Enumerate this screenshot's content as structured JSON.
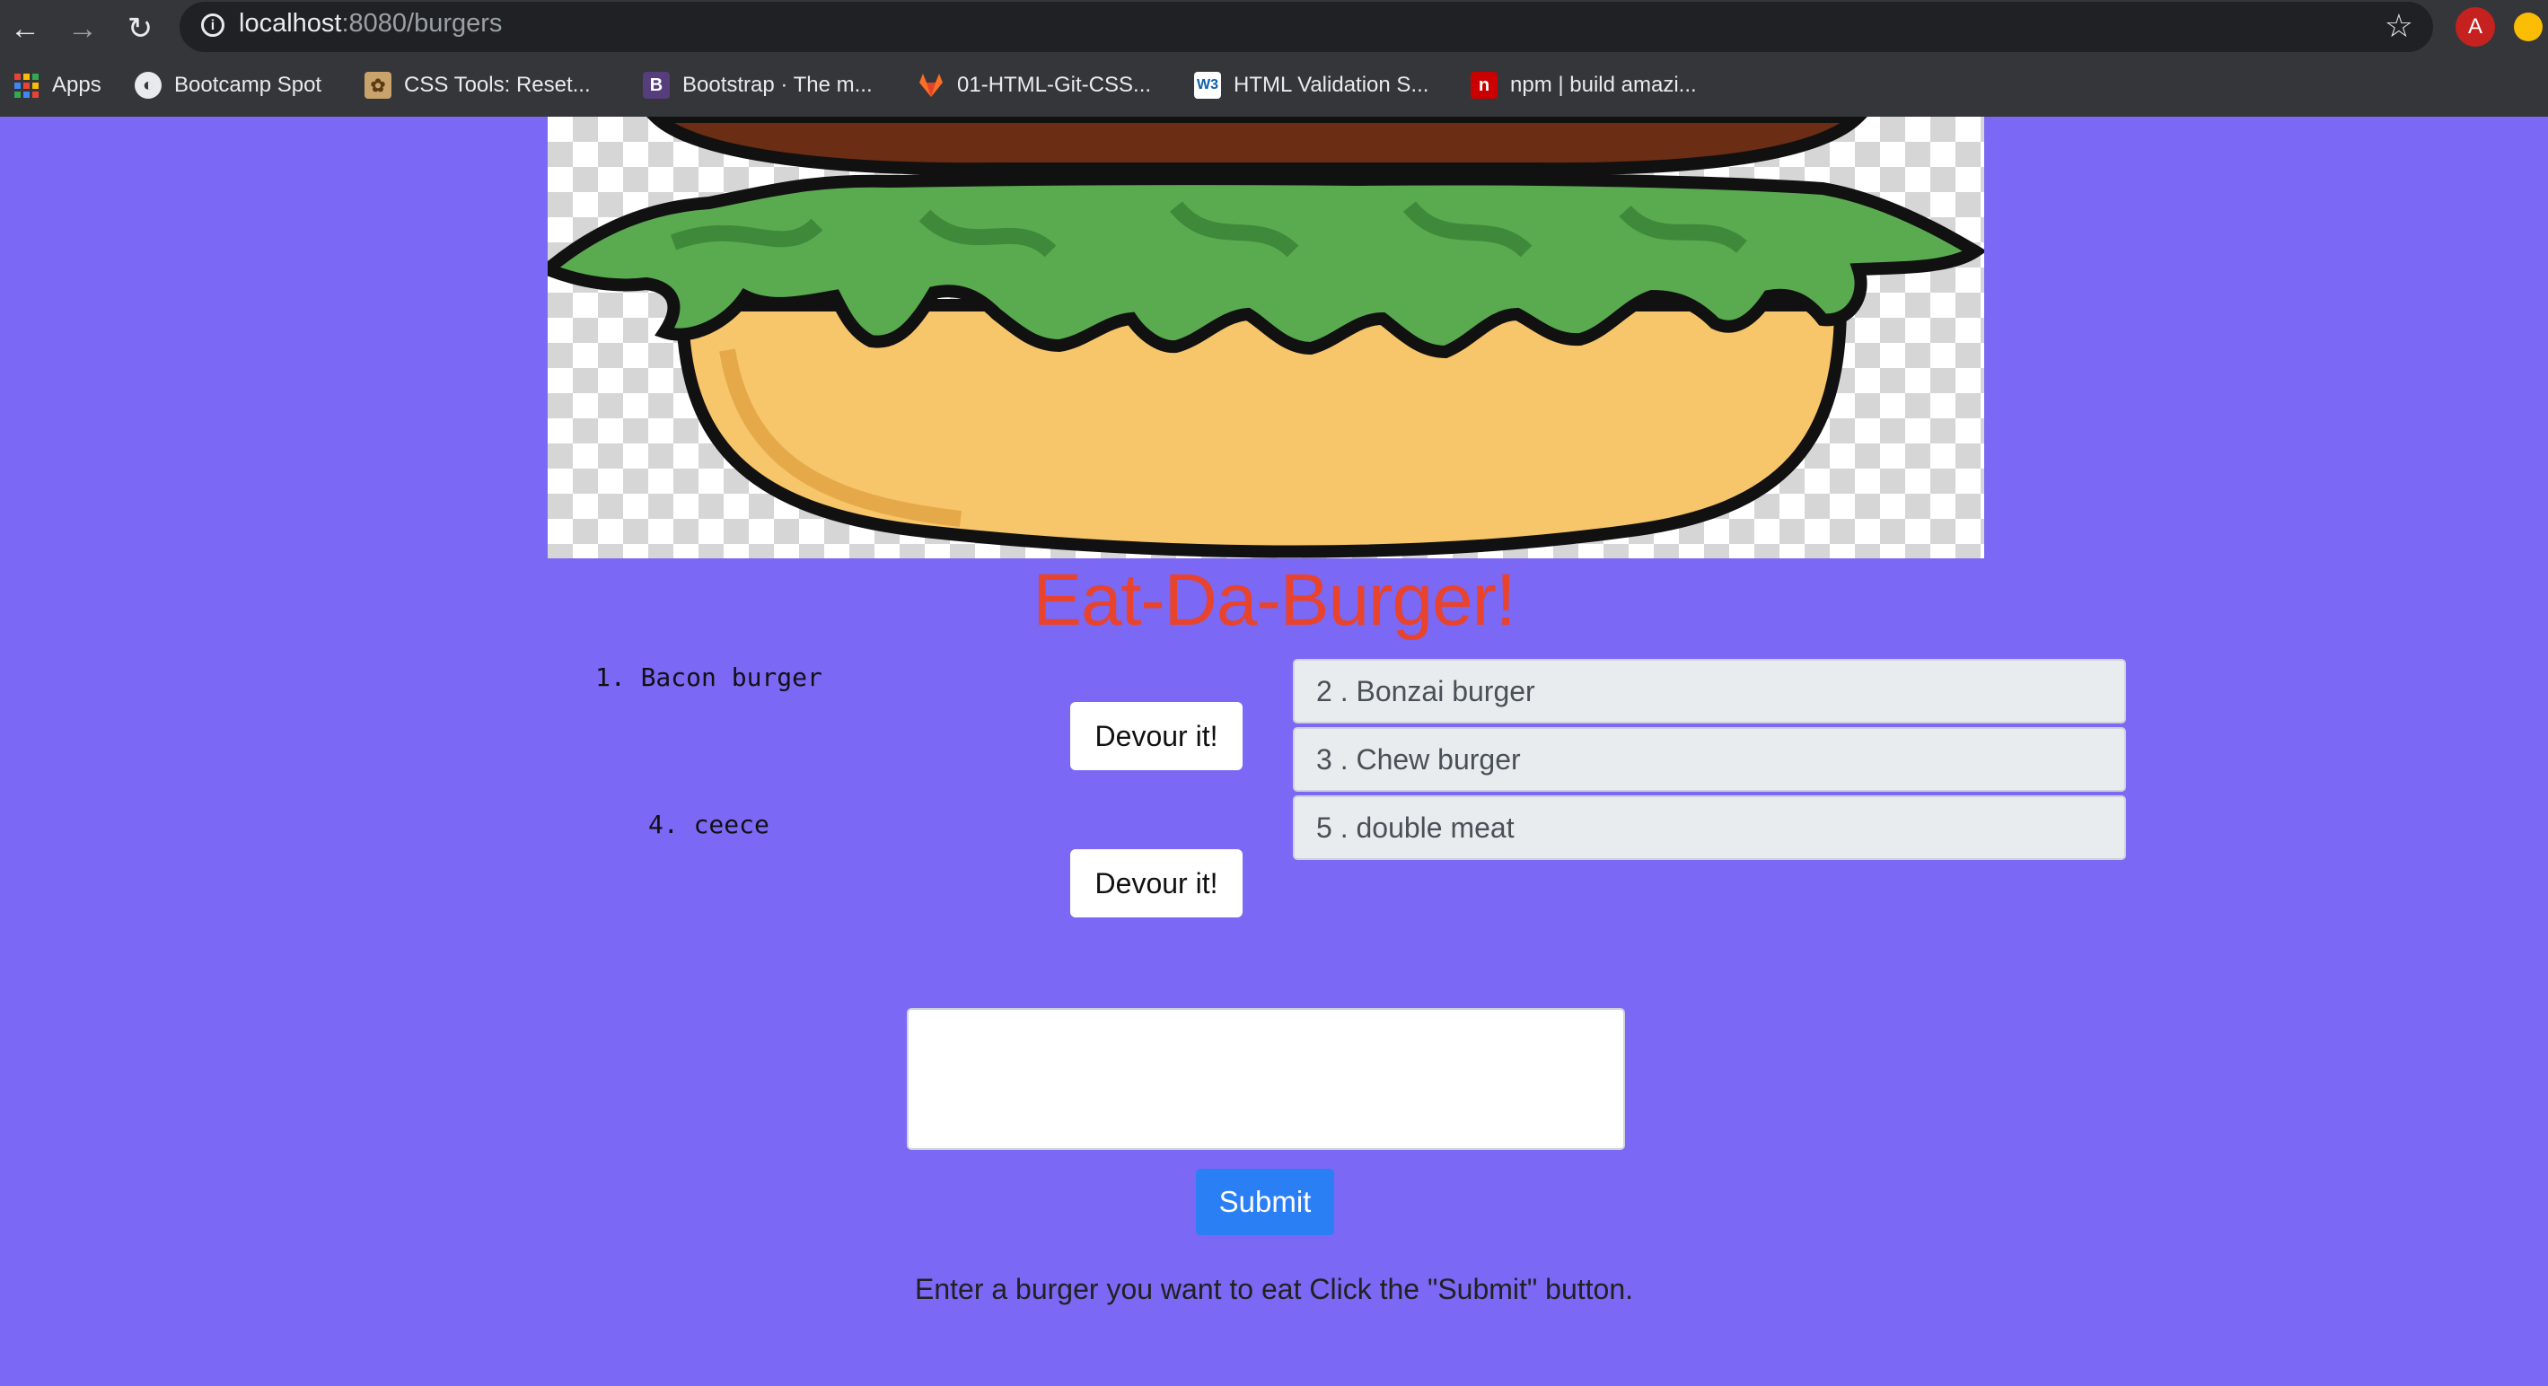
{
  "browser": {
    "url_host": "localhost",
    "url_path": ":8080/burgers",
    "avatar_letter": "A",
    "bookmarks": [
      {
        "label": "Apps",
        "icon": "apps-grid-icon"
      },
      {
        "label": "Bootcamp Spot",
        "icon": "globe-icon"
      },
      {
        "label": "CSS Tools: Reset...",
        "icon": "css-tools-icon"
      },
      {
        "label": "Bootstrap · The m...",
        "icon": "bootstrap-icon",
        "glyph": "B"
      },
      {
        "label": "01-HTML-Git-CSS...",
        "icon": "gitlab-icon"
      },
      {
        "label": "HTML Validation S...",
        "icon": "w3c-icon",
        "glyph": "W3"
      },
      {
        "label": "npm | build amazi...",
        "icon": "npm-icon",
        "glyph": "n"
      }
    ]
  },
  "page": {
    "title": "Eat-Da-Burger!",
    "uneaten": [
      {
        "label": "1. Bacon burger",
        "button": "Devour it!"
      },
      {
        "label": "4. ceece",
        "button": "Devour it!"
      }
    ],
    "eaten": [
      {
        "label": "2 . Bonzai burger"
      },
      {
        "label": "3 . Chew burger"
      },
      {
        "label": "5 . double meat"
      }
    ],
    "input_value": "",
    "submit_label": "Submit",
    "instructions": "Enter a burger you want to eat Click the \"Submit\" button."
  },
  "colors": {
    "page_background": "#7b68f5",
    "title": "#e8432d",
    "submit": "#2b7ff5",
    "eaten_item_bg": "#e9ecef"
  }
}
